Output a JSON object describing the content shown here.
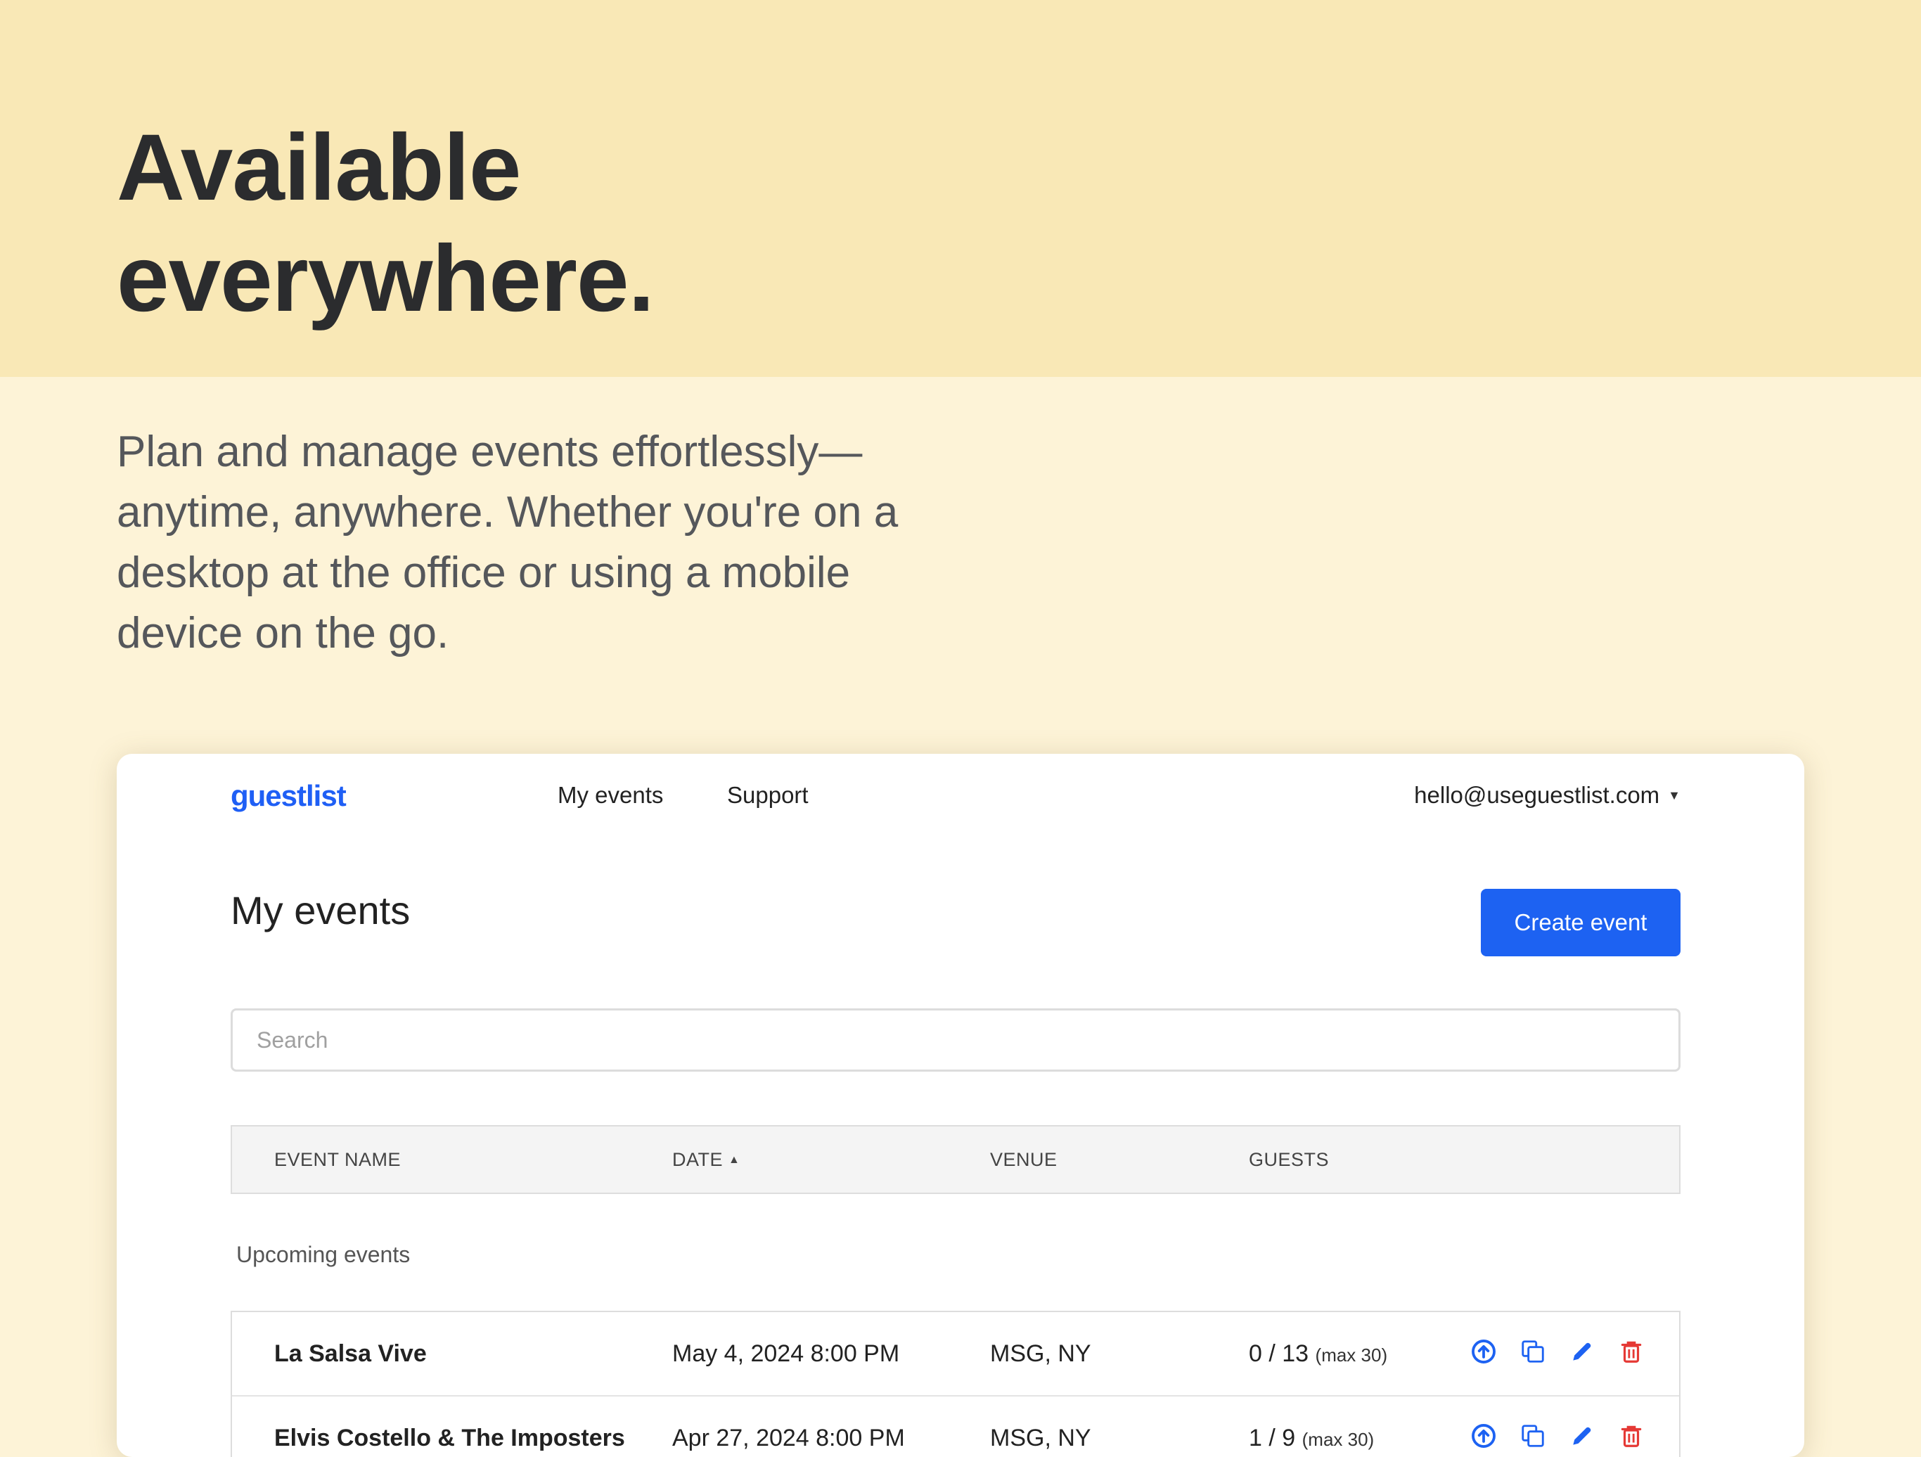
{
  "hero": {
    "title_line1": "Available",
    "title_line2": "everywhere.",
    "subtitle": "Plan and manage events effortlessly—anytime, anywhere. Whether you're on a desktop at the office or using a mobile device on the go."
  },
  "app": {
    "logo": "guestlist",
    "nav": {
      "my_events": "My events",
      "support": "Support"
    },
    "user_email": "hello@useguestlist.com",
    "page_title": "My events",
    "create_button": "Create event",
    "search_placeholder": "Search",
    "table": {
      "headers": {
        "name": "EVENT NAME",
        "date": "DATE",
        "venue": "VENUE",
        "guests": "GUESTS"
      },
      "section_label": "Upcoming events",
      "rows": [
        {
          "name": "La Salsa Vive",
          "date": "May 4, 2024 8:00 PM",
          "venue": "MSG, NY",
          "guests": "0 / 13",
          "max": "(max 30)"
        },
        {
          "name": "Elvis Costello & The Imposters",
          "date": "Apr 27, 2024 8:00 PM",
          "venue": "MSG, NY",
          "guests": "1 / 9",
          "max": "(max 30)"
        }
      ]
    },
    "icons": {
      "publish": "arrow-up-circle-icon",
      "duplicate": "copy-icon",
      "edit": "pencil-icon",
      "delete": "trash-icon"
    },
    "colors": {
      "accent": "#1d62f2",
      "danger": "#e53935",
      "hero_band": "#f9e8b6",
      "background": "#fdf3d7"
    }
  }
}
